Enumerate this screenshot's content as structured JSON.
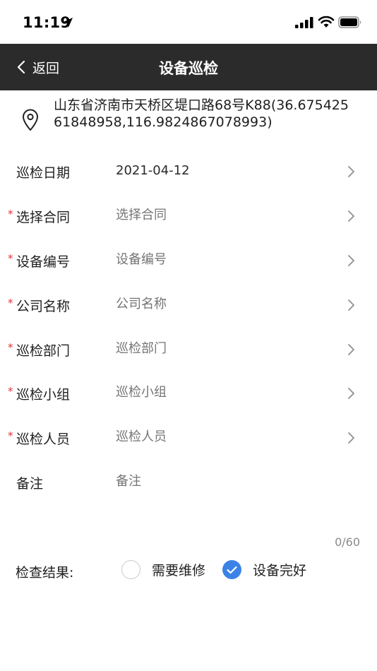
{
  "status_bar": {
    "time": "11:19"
  },
  "nav": {
    "back_label": "返回",
    "title": "设备巡检"
  },
  "location": {
    "address": "山东省济南市天桥区堤口路68号K88(36.67542561848958,116.9824867078993)"
  },
  "form": {
    "rows": [
      {
        "label": "巡检日期",
        "value": "2021-04-12",
        "placeholder": "",
        "required": false
      },
      {
        "label": "选择合同",
        "value": "",
        "placeholder": "选择合同",
        "required": true
      },
      {
        "label": "设备编号",
        "value": "",
        "placeholder": "设备编号",
        "required": true
      },
      {
        "label": "公司名称",
        "value": "",
        "placeholder": "公司名称",
        "required": true
      },
      {
        "label": "巡检部门",
        "value": "",
        "placeholder": "巡检部门",
        "required": true
      },
      {
        "label": "巡检小组",
        "value": "",
        "placeholder": "巡检小组",
        "required": true
      },
      {
        "label": "巡检人员",
        "value": "",
        "placeholder": "巡检人员",
        "required": true
      }
    ],
    "required_mark": "*",
    "remark": {
      "label": "备注",
      "placeholder": "备注",
      "value": ""
    },
    "remark_counter": "0/60"
  },
  "check": {
    "label": "检查结果:",
    "options": [
      {
        "label": "需要维修",
        "checked": false
      },
      {
        "label": "设备完好",
        "checked": true
      }
    ]
  },
  "colors": {
    "nav_bg": "#2b2b2b",
    "accent": "#3b82e6",
    "required": "#e0353a"
  }
}
